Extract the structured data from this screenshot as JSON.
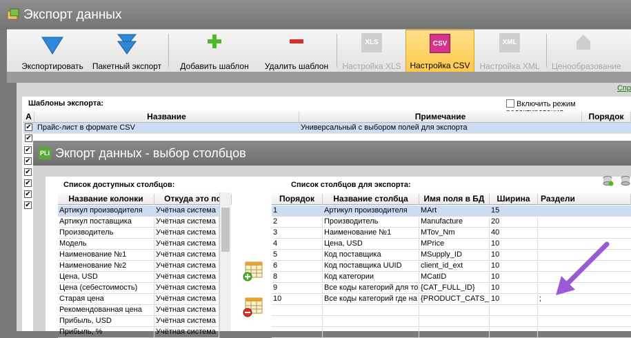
{
  "main": {
    "title": "Экспорт данных"
  },
  "ribbon": {
    "export": "Экспортировать",
    "batch_export": "Пакетный экспорт",
    "add_template": "Добавить шаблон",
    "remove_template": "Удалить шаблон",
    "xls_settings": "Настройка XLS",
    "csv_settings": "Настройка CSV",
    "xml_settings": "Настройка XML",
    "pricing": "Ценообразование",
    "xls_icon": "XLS",
    "csv_icon": "CSV",
    "xml_icon": "XML"
  },
  "templates": {
    "link": "Спр",
    "title": "Шаблоны экспорта:",
    "edit_mode": "Включить режим редактирования",
    "headers": {
      "a": "А",
      "name": "Название",
      "note": "Примечание",
      "order": "Порядок"
    },
    "rows": [
      {
        "name": "Прайс-лист в формате CSV",
        "note": "Универсальный с выбором полей для экспорта",
        "checked": true
      }
    ]
  },
  "dialog": {
    "title": "Экпорт данных - выбор столбцов",
    "available_title": "Список доступных столбцов:",
    "export_title": "Список столбцов для экспорта:",
    "available_headers": {
      "name": "Название колонки",
      "source": "Откуда это по"
    },
    "available_rows": [
      {
        "name": "Артикул производителя",
        "source": "Учётная система"
      },
      {
        "name": "Артикул поставщика",
        "source": "Учётная система"
      },
      {
        "name": "Производитель",
        "source": "Учётная система"
      },
      {
        "name": "Модель",
        "source": "Учётная система"
      },
      {
        "name": "Наименование №1",
        "source": "Учётная система"
      },
      {
        "name": "Наименование №2",
        "source": "Учётная система"
      },
      {
        "name": "Цена, USD",
        "source": "Учётная система"
      },
      {
        "name": "Цена (себестоимость)",
        "source": "Учётная система"
      },
      {
        "name": "Старая цена",
        "source": "Учётная система"
      },
      {
        "name": "Рекомендованная цена",
        "source": "Учётная система"
      },
      {
        "name": "Прибыль, USD",
        "source": "Учётная система"
      },
      {
        "name": "Прибыль, %",
        "source": "Учётная система"
      }
    ],
    "export_headers": {
      "order": "Порядок",
      "col_name": "Название столбца",
      "db_field": "Имя поля в БД",
      "width": "Ширина",
      "separator": "Раздели"
    },
    "export_rows": [
      {
        "order": "1",
        "col_name": "Артикул производителя",
        "db_field": "MArt",
        "width": "15",
        "separator": ""
      },
      {
        "order": "2",
        "col_name": "Производитель",
        "db_field": "Manufacture",
        "width": "20",
        "separator": ""
      },
      {
        "order": "3",
        "col_name": "Наименование №1",
        "db_field": "MTov_Nm",
        "width": "40",
        "separator": ""
      },
      {
        "order": "4",
        "col_name": "Цена, USD",
        "db_field": "MPrice",
        "width": "10",
        "separator": ""
      },
      {
        "order": "5",
        "col_name": "Код поставщика",
        "db_field": "MSupply_ID",
        "width": "10",
        "separator": ""
      },
      {
        "order": "6",
        "col_name": "Код поставщика UUID",
        "db_field": "client_id_ext",
        "width": "10",
        "separator": ""
      },
      {
        "order": "8",
        "col_name": "Код категории",
        "db_field": "MCatID",
        "width": "10",
        "separator": ""
      },
      {
        "order": "9",
        "col_name": "Все коды категорий для то",
        "db_field": "{CAT_FULL_ID}",
        "width": "10",
        "separator": ""
      },
      {
        "order": "10",
        "col_name": "Все коды категорий где на",
        "db_field": "{PRODUCT_CATS_ID",
        "width": "10",
        "separator": ";"
      }
    ]
  },
  "colors": {
    "arrow": "#9b59d6",
    "selection": "#ccddf3",
    "active_button": "#ffc84a",
    "csv_icon": "#d6338a"
  }
}
